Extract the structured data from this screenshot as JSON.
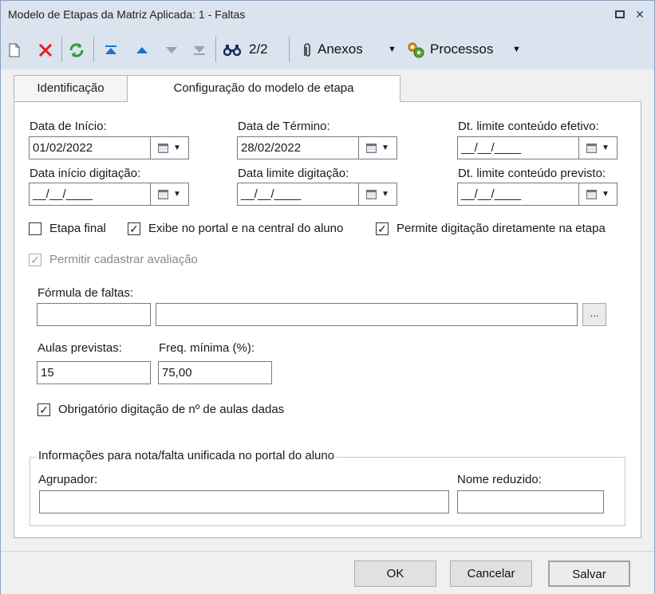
{
  "window": {
    "title": "Modelo de Etapas da Matriz Aplicada: 1 - Faltas"
  },
  "toolbar": {
    "record_counter": "2/2",
    "anexos_label": "Anexos",
    "processos_label": "Processos"
  },
  "tabs": [
    {
      "label": "Identificação",
      "active": false
    },
    {
      "label": "Configuração do modelo de etapa",
      "active": true
    }
  ],
  "dates": {
    "data_inicio": {
      "label": "Data de Início:",
      "value": "01/02/2022"
    },
    "data_termino": {
      "label": "Data de Término:",
      "value": "28/02/2022"
    },
    "dt_limite_efetivo": {
      "label": "Dt. limite conteúdo efetivo:",
      "value": "__/__/____"
    },
    "data_inicio_digitacao": {
      "label": "Data início digitação:",
      "value": "__/__/____"
    },
    "data_limite_digitacao": {
      "label": "Data limite digitação:",
      "value": "__/__/____"
    },
    "dt_limite_previsto": {
      "label": "Dt. limite conteúdo previsto:",
      "value": "__/__/____"
    }
  },
  "checkboxes": {
    "etapa_final": {
      "label": "Etapa final",
      "checked": false
    },
    "exibe_portal": {
      "label": "Exibe no portal e na central do aluno",
      "checked": true
    },
    "permite_digitacao": {
      "label": "Permite digitação diretamente na etapa",
      "checked": true
    },
    "permitir_avaliacao": {
      "label": "Permitir cadastrar avaliação",
      "checked": true,
      "disabled": true
    },
    "obrigatorio_aulas": {
      "label": "Obrigatório digitação de nº de aulas dadas",
      "checked": true
    }
  },
  "formula": {
    "label": "Fórmula de faltas:",
    "code": "",
    "description": "",
    "lookup_label": "..."
  },
  "aulas_previstas": {
    "label": "Aulas previstas:",
    "value": "15"
  },
  "freq_minima": {
    "label": "Freq. mínima (%):",
    "value": "75,00"
  },
  "unificada": {
    "title": "Informações para nota/falta unificada no portal do aluno",
    "agrupador_label": "Agrupador:",
    "agrupador_value": "",
    "nome_reduzido_label": "Nome reduzido:",
    "nome_reduzido_value": ""
  },
  "footer": {
    "ok": "OK",
    "cancelar": "Cancelar",
    "salvar": "Salvar"
  },
  "colors": {
    "titlebar": "#dbe3ee",
    "delete_red": "#e02020",
    "refresh_green": "#2e9b3a",
    "nav_blue": "#1f6fd1"
  }
}
